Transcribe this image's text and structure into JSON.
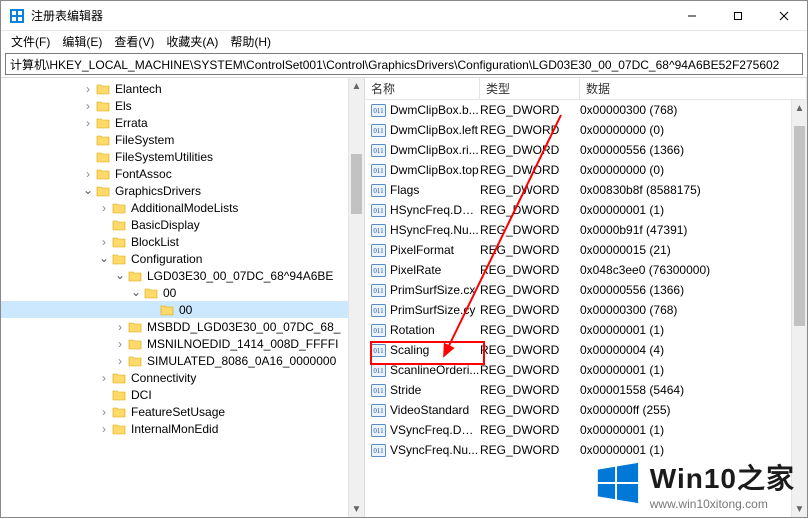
{
  "titlebar": {
    "title": "注册表编辑器"
  },
  "menu": {
    "file": "文件(F)",
    "edit": "编辑(E)",
    "view": "查看(V)",
    "fav": "收藏夹(A)",
    "help": "帮助(H)"
  },
  "address": "计算机\\HKEY_LOCAL_MACHINE\\SYSTEM\\ControlSet001\\Control\\GraphicsDrivers\\Configuration\\LGD03E30_00_07DC_68^94A6BE52F275602",
  "tree": [
    {
      "indent": 5,
      "twisty": "closed",
      "label": "Elantech"
    },
    {
      "indent": 5,
      "twisty": "closed",
      "label": "Els"
    },
    {
      "indent": 5,
      "twisty": "closed",
      "label": "Errata"
    },
    {
      "indent": 5,
      "twisty": "none",
      "label": "FileSystem"
    },
    {
      "indent": 5,
      "twisty": "none",
      "label": "FileSystemUtilities"
    },
    {
      "indent": 5,
      "twisty": "closed",
      "label": "FontAssoc"
    },
    {
      "indent": 5,
      "twisty": "open",
      "label": "GraphicsDrivers"
    },
    {
      "indent": 6,
      "twisty": "closed",
      "label": "AdditionalModeLists"
    },
    {
      "indent": 6,
      "twisty": "none",
      "label": "BasicDisplay"
    },
    {
      "indent": 6,
      "twisty": "closed",
      "label": "BlockList"
    },
    {
      "indent": 6,
      "twisty": "open",
      "label": "Configuration"
    },
    {
      "indent": 7,
      "twisty": "open",
      "label": "LGD03E30_00_07DC_68^94A6BE"
    },
    {
      "indent": 8,
      "twisty": "open",
      "label": "00"
    },
    {
      "indent": 9,
      "twisty": "none",
      "label": "00",
      "selected": true
    },
    {
      "indent": 7,
      "twisty": "closed",
      "label": "MSBDD_LGD03E30_00_07DC_68_"
    },
    {
      "indent": 7,
      "twisty": "closed",
      "label": "MSNILNOEDID_1414_008D_FFFFI"
    },
    {
      "indent": 7,
      "twisty": "closed",
      "label": "SIMULATED_8086_0A16_0000000"
    },
    {
      "indent": 6,
      "twisty": "closed",
      "label": "Connectivity"
    },
    {
      "indent": 6,
      "twisty": "none",
      "label": "DCI"
    },
    {
      "indent": 6,
      "twisty": "closed",
      "label": "FeatureSetUsage"
    },
    {
      "indent": 6,
      "twisty": "closed",
      "label": "InternalMonEdid"
    }
  ],
  "list": {
    "headers": {
      "name": "名称",
      "type": "类型",
      "data": "数据"
    },
    "rows": [
      {
        "name": "DwmClipBox.b...",
        "type": "REG_DWORD",
        "data": "0x00000300 (768)"
      },
      {
        "name": "DwmClipBox.left",
        "type": "REG_DWORD",
        "data": "0x00000000 (0)"
      },
      {
        "name": "DwmClipBox.ri...",
        "type": "REG_DWORD",
        "data": "0x00000556 (1366)"
      },
      {
        "name": "DwmClipBox.top",
        "type": "REG_DWORD",
        "data": "0x00000000 (0)"
      },
      {
        "name": "Flags",
        "type": "REG_DWORD",
        "data": "0x00830b8f (8588175)"
      },
      {
        "name": "HSyncFreq.Den...",
        "type": "REG_DWORD",
        "data": "0x00000001 (1)"
      },
      {
        "name": "HSyncFreq.Nu...",
        "type": "REG_DWORD",
        "data": "0x0000b91f (47391)"
      },
      {
        "name": "PixelFormat",
        "type": "REG_DWORD",
        "data": "0x00000015 (21)"
      },
      {
        "name": "PixelRate",
        "type": "REG_DWORD",
        "data": "0x048c3ee0 (76300000)"
      },
      {
        "name": "PrimSurfSize.cx",
        "type": "REG_DWORD",
        "data": "0x00000556 (1366)"
      },
      {
        "name": "PrimSurfSize.cy",
        "type": "REG_DWORD",
        "data": "0x00000300 (768)"
      },
      {
        "name": "Rotation",
        "type": "REG_DWORD",
        "data": "0x00000001 (1)"
      },
      {
        "name": "Scaling",
        "type": "REG_DWORD",
        "data": "0x00000004 (4)"
      },
      {
        "name": "ScanlineOrderi...",
        "type": "REG_DWORD",
        "data": "0x00000001 (1)"
      },
      {
        "name": "Stride",
        "type": "REG_DWORD",
        "data": "0x00001558 (5464)"
      },
      {
        "name": "VideoStandard",
        "type": "REG_DWORD",
        "data": "0x000000ff (255)"
      },
      {
        "name": "VSyncFreq.Den...",
        "type": "REG_DWORD",
        "data": "0x00000001 (1)"
      },
      {
        "name": "VSyncFreq.Nu...",
        "type": "REG_DWORD",
        "data": "0x00000001 (1)"
      }
    ],
    "highlight_index": 12
  },
  "watermark": {
    "brand_en": "Win10",
    "brand_zh": "之家",
    "url": "www.win10xitong.com"
  },
  "colors": {
    "highlight": "#ff0000",
    "selection": "#cce8ff",
    "win_blue": "#0078d7"
  }
}
